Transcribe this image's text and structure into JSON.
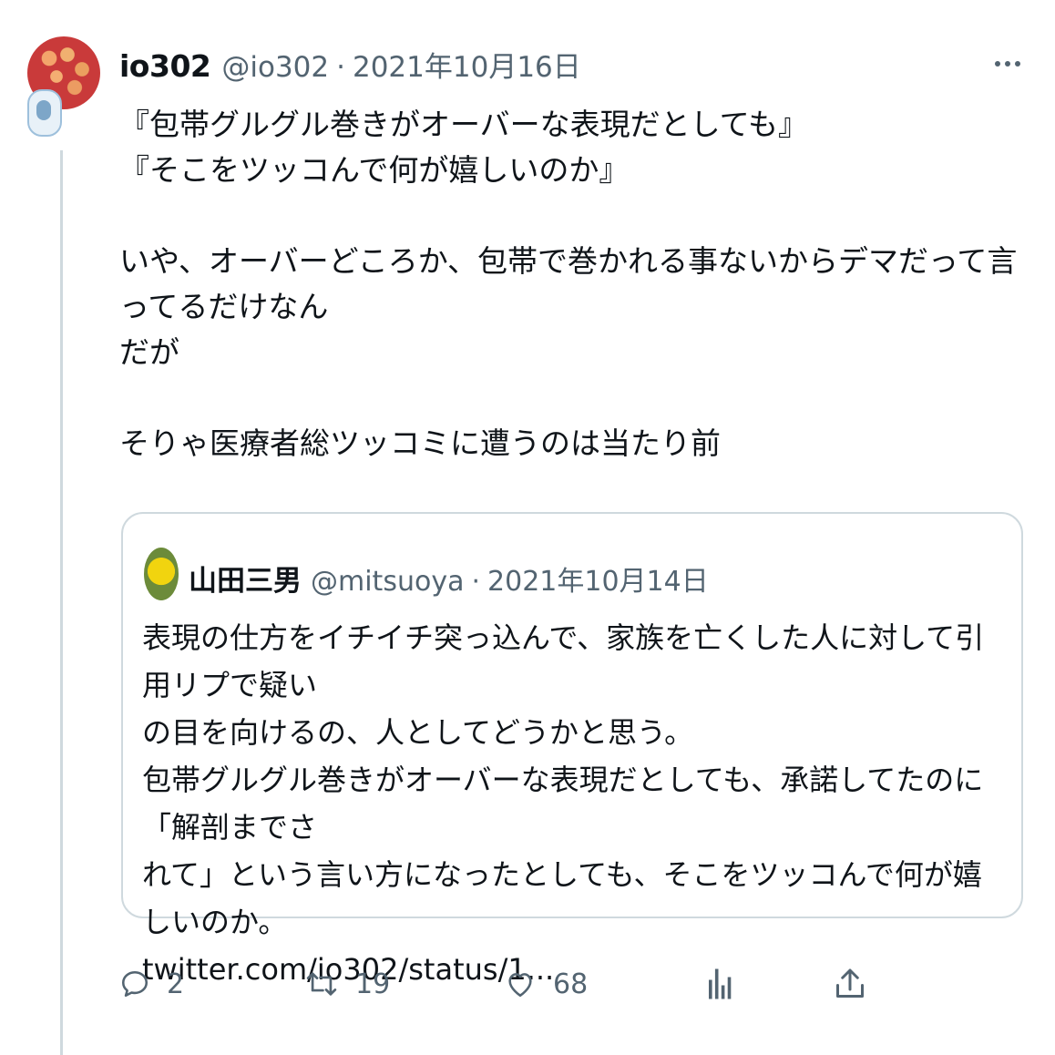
{
  "tweet": {
    "display_name": "io302",
    "handle": "@io302",
    "separator": "·",
    "date": "2021年10月16日",
    "body_lines": [
      "『包帯グルグル巻きがオーバーな表現だとしても』",
      "『そこをツッコんで何が嬉しいのか』",
      "",
      "いや、オーバーどころか、包帯で巻かれる事ないからデマだって言ってるだけなん",
      "だが",
      "",
      "そりゃ医療者総ツッコミに遭うのは当たり前"
    ]
  },
  "quote": {
    "display_name": "山田三男",
    "handle": "@mitsuoya",
    "separator": "·",
    "date": "2021年10月14日",
    "body_lines": [
      "表現の仕方をイチイチ突っ込んで、家族を亡くした人に対して引用リプで疑い",
      "の目を向けるの、人としてどうかと思う。",
      "包帯グルグル巻きがオーバーな表現だとしても、承諾してたのに「解剖までさ",
      "れて」という言い方になったとしても、そこをツッコんで何が嬉しいのか。",
      "twitter.com/io302/status/1..."
    ]
  },
  "actions": {
    "reply_count": "2",
    "retweet_count": "19",
    "like_count": "68"
  },
  "icons": {
    "more": "more-icon",
    "reply": "reply-icon",
    "retweet": "retweet-icon",
    "like": "heart-icon",
    "analytics": "analytics-icon",
    "share": "share-icon"
  },
  "colors": {
    "text": "#0f1419",
    "secondary": "#536471",
    "border": "#cfd9de"
  }
}
